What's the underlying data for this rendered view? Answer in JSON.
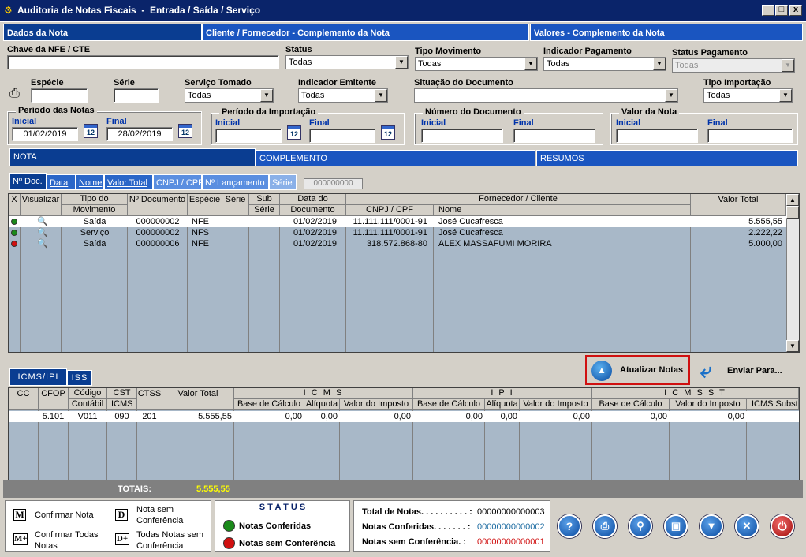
{
  "window": {
    "title": "Auditoria de Notas Fiscais  -  Entrada / Saída / Serviço"
  },
  "top_tabs": [
    "Dados da Nota",
    "Cliente / Fornecedor - Complemento da Nota",
    "Valores - Complemento da Nota"
  ],
  "filters": {
    "chave_label": "Chave da NFE / CTE",
    "chave_value": "",
    "status_label": "Status",
    "status_value": "Todas",
    "tipo_mov_label": "Tipo Movimento",
    "tipo_mov_value": "Todas",
    "ind_pag_label": "Indicador Pagamento",
    "ind_pag_value": "Todas",
    "status_pag_label": "Status Pagamento",
    "status_pag_value": "Todas",
    "especie_label": "Espécie",
    "especie_value": "",
    "serie_label": "Série",
    "serie_value": "",
    "servico_label": "Serviço Tomado",
    "servico_value": "Todas",
    "ind_emit_label": "Indicador Emitente",
    "ind_emit_value": "Todas",
    "situacao_label": "Situação do Documento",
    "situacao_value": "",
    "tipo_imp_label": "Tipo Importação",
    "tipo_imp_value": "Todas"
  },
  "groups": {
    "periodo_notas": {
      "title": "Período das Notas",
      "inicial_label": "Inicial",
      "final_label": "Final",
      "inicial": "01/02/2019",
      "final": "28/02/2019"
    },
    "periodo_import": {
      "title": "Período da Importação",
      "inicial_label": "Inicial",
      "final_label": "Final"
    },
    "numero_doc": {
      "title": "Número do Documento",
      "inicial_label": "Inicial",
      "final_label": "Final"
    },
    "valor_nota": {
      "title": "Valor da Nota",
      "inicial_label": "Inicial",
      "final_label": "Final"
    },
    "calendar_day": "12"
  },
  "section_tabs": [
    "NOTA",
    "COMPLEMENTO",
    "RESUMOS"
  ],
  "sort_tabs": [
    "Nº Doc.",
    "Data",
    "Nome",
    "Valor Total",
    "CNPJ / CPF",
    "Nº Lançamento",
    "Série"
  ],
  "sort_search": "000000000",
  "notes_grid": {
    "headers": {
      "x": "X",
      "visualizar": "Visualizar",
      "tipo1": "Tipo do",
      "tipo2": "Movimento",
      "ndoc": "Nº Documento",
      "especie": "Espécie",
      "serie": "Série",
      "sub1": "Sub",
      "sub2": "Série",
      "data1": "Data do",
      "data2": "Documento",
      "forn": "Fornecedor / Cliente",
      "cnpj": "CNPJ / CPF",
      "nome": "Nome",
      "valor": "Valor Total"
    },
    "rows": [
      {
        "status": "#1a8a1a",
        "tipo": "Saída",
        "ndoc": "000000002",
        "especie": "NFE",
        "data": "01/02/2019",
        "cnpj": "11.111.111/0001-91",
        "nome": "José Cucafresca",
        "valor": "5.555,55"
      },
      {
        "status": "#1a8a1a",
        "tipo": "Serviço",
        "ndoc": "000000002",
        "especie": "NFS",
        "data": "01/02/2019",
        "cnpj": "11.111.111/0001-91",
        "nome": "José Cucafresca",
        "valor": "2.222,22"
      },
      {
        "status": "#d01010",
        "tipo": "Saída",
        "ndoc": "000000006",
        "especie": "NFE",
        "data": "01/02/2019",
        "cnpj": "318.572.868-80",
        "nome": "ALEX MASSAFUMI  MORIRA",
        "valor": "5.000,00"
      }
    ]
  },
  "bottom_tabs": [
    "ICMS/IPI",
    "ISS"
  ],
  "actions": {
    "atualizar": "Atualizar Notas",
    "enviar": "Enviar Para..."
  },
  "tax_grid": {
    "headers": {
      "cc": "CC",
      "cfop": "CFOP",
      "cod1": "Código",
      "cod2": "Contábil",
      "cst1": "CST",
      "cst2": "ICMS",
      "ctss": "CTSS",
      "vt": "Valor Total",
      "icms": "I C M S",
      "ipi": "I P I",
      "icmsst": "I C M S   S T",
      "bc": "Base de Cálculo",
      "aliq": "Alíquota",
      "vi": "Valor do Imposto",
      "icmssubst": "ICMS Substit"
    },
    "row": {
      "cc": "",
      "cfop": "5.101",
      "cod": "V011",
      "cst": "090",
      "ctss": "201",
      "vt": "5.555,55",
      "icms_bc": "0,00",
      "icms_aliq": "0,00",
      "icms_vi": "0,00",
      "ipi_bc": "0,00",
      "ipi_aliq": "0,00",
      "ipi_vi": "0,00",
      "st_bc": "0,00",
      "st_vi": "0,00"
    }
  },
  "totals": {
    "label": "TOTAIS:",
    "value": "5.555,55"
  },
  "legend": {
    "m": "M",
    "m_label": "Confirmar Nota",
    "mp": "M+",
    "mp_label1": "Confirmar Todas",
    "mp_label2": "Notas",
    "d": "D",
    "d_label1": "Nota sem",
    "d_label2": "Conferência",
    "dp": "D+",
    "dp_label1": "Todas Notas sem",
    "dp_label2": "Conferência"
  },
  "status_box": {
    "title": "S T A T U S",
    "ok": "Notas Conferidas",
    "nok": "Notas sem Conferência",
    "ok_color": "#1a8a1a",
    "nok_color": "#d01010"
  },
  "summary": {
    "total_label": "Total de Notas. . . . . . . . . . :",
    "total_value": "00000000000003",
    "conf_label": "Notas Conferidas. . . . . . . :",
    "conf_value": "00000000000002",
    "sem_label": "Notas sem Conferência. :",
    "sem_value": "00000000000001"
  },
  "toolbar_icons": [
    "help-icon",
    "print-icon",
    "search-icon",
    "preview-icon",
    "filter-icon",
    "clear-filter-icon",
    "power-icon"
  ]
}
